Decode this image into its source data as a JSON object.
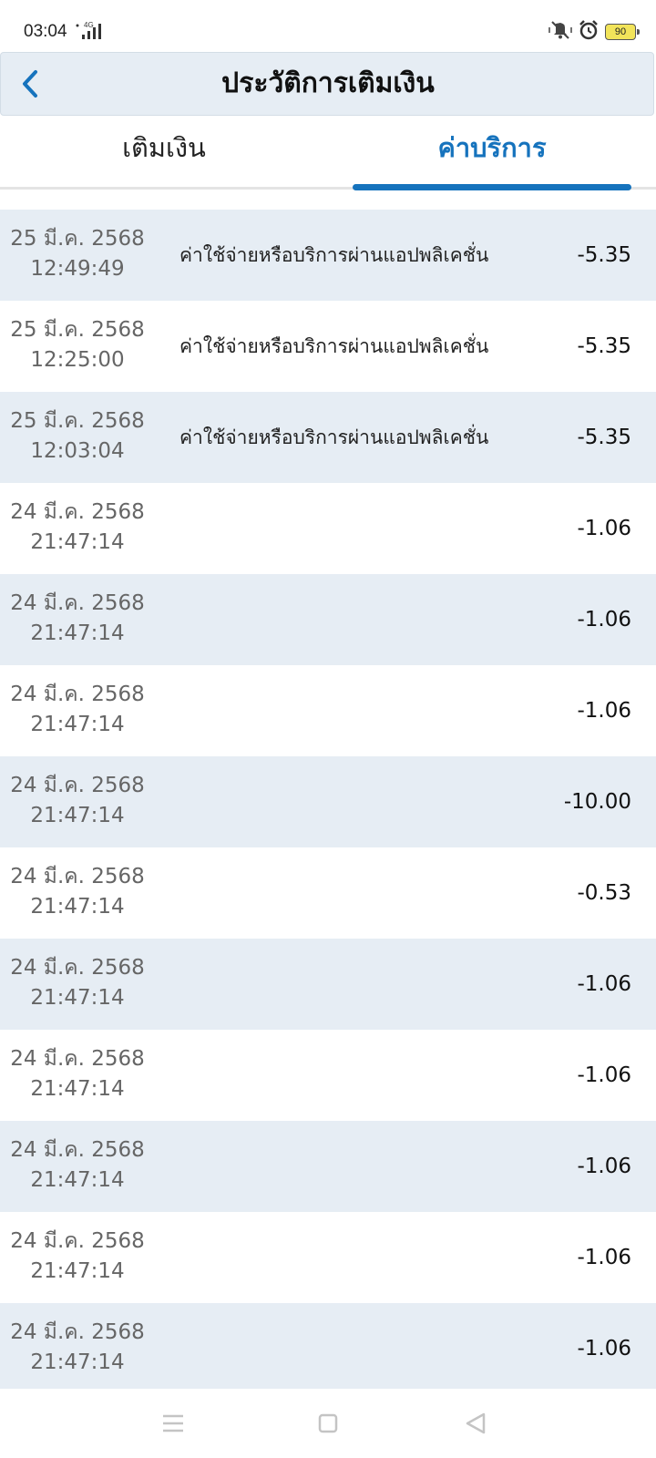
{
  "status_bar": {
    "time": "03:04",
    "network_label": "4G",
    "battery": "90"
  },
  "header": {
    "title": "ประวัติการเติมเงิน"
  },
  "tabs": [
    {
      "label": "เติมเงิน",
      "active": false
    },
    {
      "label": "ค่าบริการ",
      "active": true
    }
  ],
  "colors": {
    "accent": "#1673bd",
    "row_shade": "#e6edf4"
  },
  "transactions": [
    {
      "date": "25 มี.ค. 2568",
      "time": "12:49:49",
      "description": "ค่าใช้จ่ายหรือบริการผ่านแอปพลิเคชั่น",
      "amount": "-5.35"
    },
    {
      "date": "25 มี.ค. 2568",
      "time": "12:25:00",
      "description": "ค่าใช้จ่ายหรือบริการผ่านแอปพลิเคชั่น",
      "amount": "-5.35"
    },
    {
      "date": "25 มี.ค. 2568",
      "time": "12:03:04",
      "description": "ค่าใช้จ่ายหรือบริการผ่านแอปพลิเคชั่น",
      "amount": "-5.35"
    },
    {
      "date": "24 มี.ค. 2568",
      "time": "21:47:14",
      "description": "",
      "amount": "-1.06"
    },
    {
      "date": "24 มี.ค. 2568",
      "time": "21:47:14",
      "description": "",
      "amount": "-1.06"
    },
    {
      "date": "24 มี.ค. 2568",
      "time": "21:47:14",
      "description": "",
      "amount": "-1.06"
    },
    {
      "date": "24 มี.ค. 2568",
      "time": "21:47:14",
      "description": "",
      "amount": "-10.00"
    },
    {
      "date": "24 มี.ค. 2568",
      "time": "21:47:14",
      "description": "",
      "amount": "-0.53"
    },
    {
      "date": "24 มี.ค. 2568",
      "time": "21:47:14",
      "description": "",
      "amount": "-1.06"
    },
    {
      "date": "24 มี.ค. 2568",
      "time": "21:47:14",
      "description": "",
      "amount": "-1.06"
    },
    {
      "date": "24 มี.ค. 2568",
      "time": "21:47:14",
      "description": "",
      "amount": "-1.06"
    },
    {
      "date": "24 มี.ค. 2568",
      "time": "21:47:14",
      "description": "",
      "amount": "-1.06"
    },
    {
      "date": "24 มี.ค. 2568",
      "time": "21:47:14",
      "description": "",
      "amount": "-1.06"
    }
  ]
}
